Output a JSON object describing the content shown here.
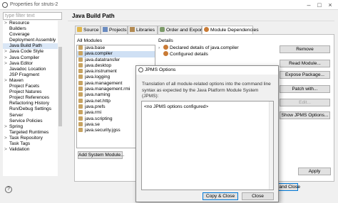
{
  "window": {
    "title": "Properties for struts-2"
  },
  "filter": {
    "placeholder": "type filter text"
  },
  "tree": {
    "items": [
      {
        "label": "Resource",
        "expander": ">"
      },
      {
        "label": "Builders",
        "expander": ""
      },
      {
        "label": "Coverage",
        "expander": ""
      },
      {
        "label": "Deployment Assembly",
        "expander": ""
      },
      {
        "label": "Java Build Path",
        "expander": "",
        "selected": true
      },
      {
        "label": "Java Code Style",
        "expander": ">"
      },
      {
        "label": "Java Compiler",
        "expander": ">"
      },
      {
        "label": "Java Editor",
        "expander": ">"
      },
      {
        "label": "Javadoc Location",
        "expander": ""
      },
      {
        "label": "JSP Fragment",
        "expander": ""
      },
      {
        "label": "Maven",
        "expander": ">"
      },
      {
        "label": "Project Facets",
        "expander": ""
      },
      {
        "label": "Project Natures",
        "expander": ""
      },
      {
        "label": "Project References",
        "expander": ""
      },
      {
        "label": "Refactoring History",
        "expander": ""
      },
      {
        "label": "Run/Debug Settings",
        "expander": ""
      },
      {
        "label": "Server",
        "expander": ""
      },
      {
        "label": "Service Policies",
        "expander": ""
      },
      {
        "label": "Spring",
        "expander": ">"
      },
      {
        "label": "Targeted Runtimes",
        "expander": ""
      },
      {
        "label": "Task Repository",
        "expander": ">"
      },
      {
        "label": "Task Tags",
        "expander": ""
      },
      {
        "label": "Validation",
        "expander": ">"
      }
    ]
  },
  "page": {
    "title": "Java Build Path"
  },
  "tabs": [
    {
      "label": "Source",
      "icon": "folder-icon"
    },
    {
      "label": "Projects",
      "icon": "project-icon"
    },
    {
      "label": "Libraries",
      "icon": "library-icon"
    },
    {
      "label": "Order and Export",
      "icon": "order-icon"
    },
    {
      "label": "Module Dependencies",
      "icon": "module-icon",
      "active": true
    }
  ],
  "modules": {
    "label": "All Modules",
    "items": [
      "java.base",
      "java.compiler",
      "java.datatransfer",
      "java.desktop",
      "java.instrument",
      "java.logging",
      "java.management",
      "java.management.rmi",
      "java.naming",
      "java.net.http",
      "java.prefs",
      "java.rmi",
      "java.scripting",
      "java.se",
      "java.security.jgss"
    ],
    "selected_index": 1,
    "add_system_label": "Add System Module..."
  },
  "details": {
    "label": "Details",
    "items": [
      "Declared details of java.compiler",
      "Configured details"
    ]
  },
  "buttons": {
    "remove": "Remove",
    "read_module": "Read Module...",
    "expose_package": "Expose Package...",
    "patch_with": "Patch with...",
    "edit": "Edit...",
    "show_jpms": "Show JPMS Options...",
    "apply": "Apply",
    "apply_close": "Apply and Close"
  },
  "dialog": {
    "title": "JPMS Options",
    "description": "Translation of all module-related options into the command line syntax as expected by the Java Platform Module System (JPMS):",
    "text": "<no JPMS options configured>",
    "copy_close": "Copy & Close",
    "close": "Close"
  },
  "colors": {
    "selection": "#d9e6f5",
    "accent_button_border": "#0078d7"
  }
}
